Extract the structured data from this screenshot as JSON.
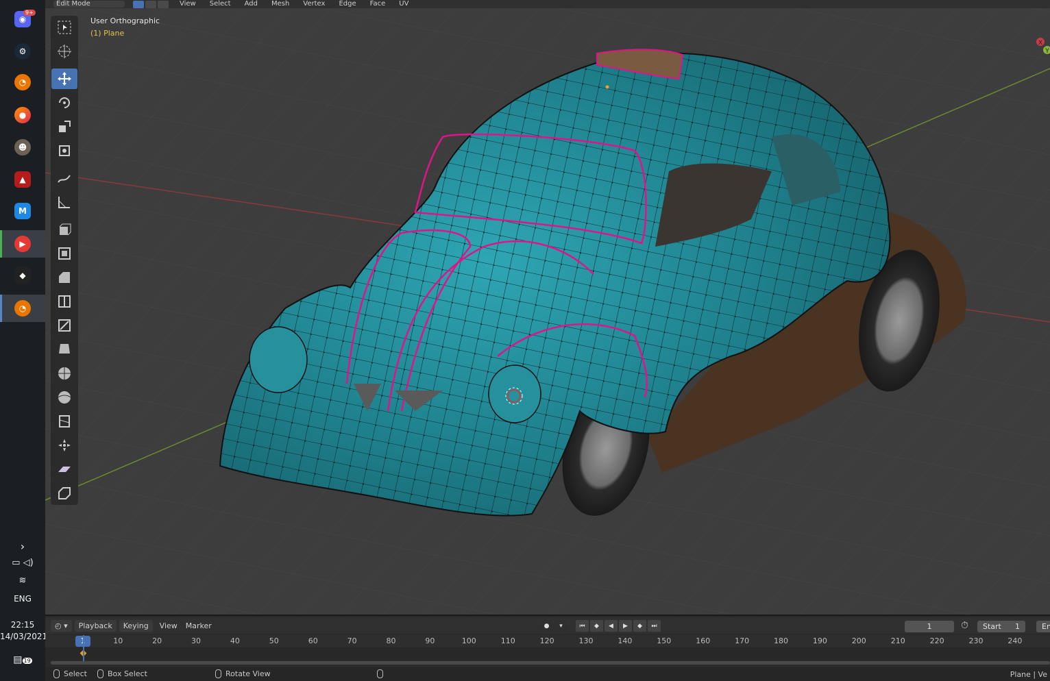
{
  "header": {
    "mode": "Edit Mode",
    "menus": [
      "View",
      "Select",
      "Add",
      "Mesh",
      "Vertex",
      "Edge",
      "Face",
      "UV"
    ]
  },
  "viewport": {
    "title": "User Orthographic",
    "object": "(1) Plane",
    "axis_x": "X",
    "axis_y": "Y"
  },
  "taskbar": {
    "apps": [
      {
        "name": "discord",
        "badge": "9+"
      },
      {
        "name": "steam"
      },
      {
        "name": "blender"
      },
      {
        "name": "firefox"
      },
      {
        "name": "gimp"
      },
      {
        "name": "game-app"
      },
      {
        "name": "substance"
      },
      {
        "name": "media-player"
      },
      {
        "name": "inkscape"
      },
      {
        "name": "blender-active"
      }
    ],
    "lang": "ENG",
    "time": "22:15",
    "date": "14/03/2021",
    "notifications": "19"
  },
  "timeline": {
    "menus": [
      "Playback",
      "Keying",
      "View",
      "Marker"
    ],
    "current_frame": "1",
    "start_label": "Start",
    "start_value": "1",
    "end_label": "En",
    "ticks": [
      "1",
      "10",
      "20",
      "30",
      "40",
      "50",
      "60",
      "70",
      "80",
      "90",
      "100",
      "110",
      "120",
      "130",
      "140",
      "150",
      "160",
      "170",
      "180",
      "190",
      "200",
      "210",
      "220",
      "230",
      "240"
    ]
  },
  "status": {
    "select": "Select",
    "box_select": "Box Select",
    "rotate_view": "Rotate View",
    "right": "Plane | Ve"
  },
  "colors": {
    "accent": "#4772b3",
    "mesh": "#1f7f8c",
    "seam": "#e0148a",
    "viewport_bg": "#3d3d3d"
  }
}
